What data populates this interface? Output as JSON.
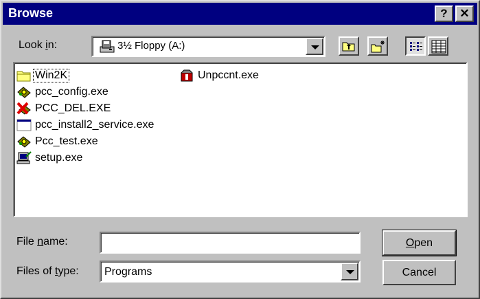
{
  "window": {
    "title": "Browse",
    "help_label": "?",
    "close_label": "✕"
  },
  "look_in": {
    "label_pre": "Look ",
    "label_accel": "i",
    "label_post": "n:",
    "value": "3½ Floppy (A:)"
  },
  "files": [
    {
      "name": "Win2K",
      "icon": "folder-icon"
    },
    {
      "name": "pcc_config.exe",
      "icon": "exe-gear-icon"
    },
    {
      "name": "PCC_DEL.EXE",
      "icon": "delete-x-icon"
    },
    {
      "name": "pcc_install2_service.exe",
      "icon": "app-window-icon"
    },
    {
      "name": "Pcc_test.exe",
      "icon": "exe-gear-icon"
    },
    {
      "name": "setup.exe",
      "icon": "setup-computer-icon"
    },
    {
      "name": "Unpccnt.exe",
      "icon": "unpccnt-package-icon"
    }
  ],
  "file_name": {
    "label_pre": "File ",
    "label_accel": "n",
    "label_post": "ame:",
    "value": ""
  },
  "file_type": {
    "label_pre": "Files of ",
    "label_accel": "t",
    "label_post": "ype:",
    "value": "Programs"
  },
  "buttons": {
    "open_accel": "O",
    "open_rest": "pen",
    "cancel": "Cancel"
  }
}
